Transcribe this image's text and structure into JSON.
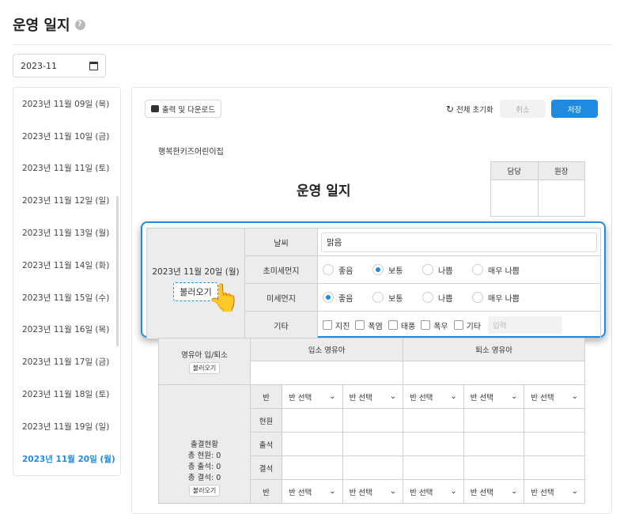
{
  "page": {
    "title": "운영 일지",
    "help_icon": "?"
  },
  "date_picker": {
    "value": "2023-11"
  },
  "sidebar": {
    "items": [
      "2023년 11월 09일 (목)",
      "2023년 11월 10일 (금)",
      "2023년 11월 11일 (토)",
      "2023년 11월 12일 (일)",
      "2023년 11월 13일 (월)",
      "2023년 11월 14일 (화)",
      "2023년 11월 15일 (수)",
      "2023년 11월 16일 (목)",
      "2023년 11월 17일 (금)",
      "2023년 11월 18일 (토)",
      "2023년 11월 19일 (일)",
      "2023년 11월 20일 (월)"
    ],
    "active_index": 11
  },
  "toolbar": {
    "print_label": "출력 및 다운로드",
    "reset_label": "전체 초기화",
    "cancel_label": "취소",
    "save_label": "저장"
  },
  "doc": {
    "org_name": "행복한키즈어린이집",
    "title": "운영 일지",
    "approval": {
      "col1": "담당",
      "col2": "원장"
    }
  },
  "info": {
    "date": "2023년 11월 20일 (월)",
    "load_label": "불러오기",
    "weather_label": "날씨",
    "weather_value": "맑음",
    "ultrafine_label": "초미세먼지",
    "fine_label": "미세먼지",
    "dust_options": [
      "좋음",
      "보통",
      "나쁨",
      "매우 나쁨"
    ],
    "ultrafine_selected": "보통",
    "fine_selected": "좋음",
    "etc_label": "기타",
    "etc_options": [
      "지진",
      "폭염",
      "태풍",
      "폭우",
      "기타"
    ],
    "etc_placeholder": "입력"
  },
  "lower": {
    "inout_label": "영유아 입/퇴소",
    "load_small": "불러오기",
    "in_label": "입소 영유아",
    "out_label": "퇴소 영유아",
    "class_label": "반",
    "enrolled_label": "현원",
    "attend_label": "출석",
    "absent_label": "결석",
    "class_select": "반 선택",
    "attendance_title": "출결현황",
    "total_enrolled": "총 현원: 0",
    "total_attend": "총 출석: 0",
    "total_absent": "총 결석: 0"
  }
}
